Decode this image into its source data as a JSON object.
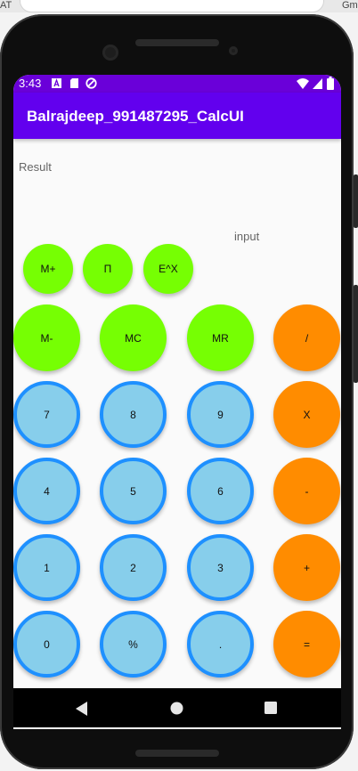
{
  "browser": {
    "left_fragment": "AT",
    "right_fragment": "Gm"
  },
  "status_bar": {
    "time": "3:43",
    "background": "#6a00d9"
  },
  "app_bar": {
    "title": "Balrajdeep_991487295_CalcUI",
    "background": "#6200ee"
  },
  "display": {
    "result_label": "Result",
    "input_label": "input"
  },
  "memory_row": [
    "M+",
    "Π",
    "E^X"
  ],
  "buttons": {
    "m_minus": "M-",
    "mc": "MC",
    "mr": "MR",
    "divide": "/",
    "seven": "7",
    "eight": "8",
    "nine": "9",
    "multiply": "X",
    "four": "4",
    "five": "5",
    "six": "6",
    "subtract": "-",
    "one": "1",
    "two": "2",
    "three": "3",
    "add": "+",
    "zero": "0",
    "percent": "%",
    "decimal": ".",
    "equals": "="
  },
  "colors": {
    "function_key": "#76ff03",
    "operator_key": "#ff8c00",
    "digit_key_fill": "#87ceeb",
    "digit_key_ring": "#1e90ff"
  }
}
